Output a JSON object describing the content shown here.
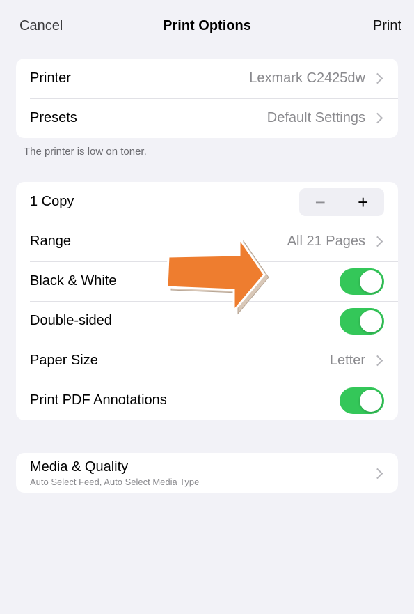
{
  "nav": {
    "cancel": "Cancel",
    "title": "Print Options",
    "print": "Print"
  },
  "printer_group": {
    "printer_label": "Printer",
    "printer_value": "Lexmark C2425dw",
    "presets_label": "Presets",
    "presets_value": "Default Settings"
  },
  "footnote": "The printer is low on toner.",
  "options_group": {
    "copies_label": "1 Copy",
    "stepper_minus": "−",
    "stepper_plus": "+",
    "range_label": "Range",
    "range_value": "All 21 Pages",
    "bw_label": "Black & White",
    "bw_on": true,
    "double_label": "Double-sided",
    "double_on": true,
    "paper_label": "Paper Size",
    "paper_value": "Letter",
    "annot_label": "Print PDF Annotations",
    "annot_on": true
  },
  "media_group": {
    "title": "Media & Quality",
    "subtitle": "Auto Select Feed, Auto Select Media Type"
  },
  "colors": {
    "toggle_on": "#34c759",
    "arrow": "#ee7d2f",
    "background": "#f2f2f7"
  }
}
